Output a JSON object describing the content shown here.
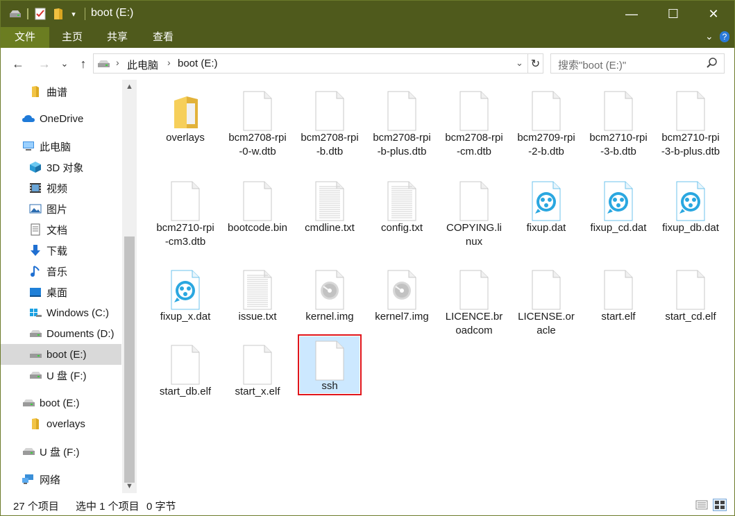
{
  "window": {
    "title": "boot (E:)",
    "minimize_glyph": "—",
    "maximize_glyph": "☐",
    "close_glyph": "✕"
  },
  "ribbon": {
    "tabs": [
      "文件",
      "主页",
      "共享",
      "查看"
    ],
    "collapse_glyph": "⌄",
    "help_glyph": "?"
  },
  "nav": {
    "back_glyph": "←",
    "forward_glyph": "→",
    "recent_glyph": "⌄",
    "up_glyph": "↑",
    "breadcrumbs": [
      "此电脑",
      "boot (E:)"
    ],
    "refresh_glyph": "↻",
    "dropdown_glyph": "⌄"
  },
  "search": {
    "placeholder": "搜索\"boot (E:)\""
  },
  "sidebar": {
    "items": [
      {
        "label": "曲谱",
        "icon": "folder-icon"
      },
      {
        "label": "OneDrive",
        "icon": "cloud-icon"
      },
      {
        "label": "此电脑",
        "icon": "computer-icon"
      },
      {
        "label": "3D 对象",
        "icon": "cube-icon"
      },
      {
        "label": "视频",
        "icon": "video-icon"
      },
      {
        "label": "图片",
        "icon": "picture-icon"
      },
      {
        "label": "文档",
        "icon": "document-icon"
      },
      {
        "label": "下载",
        "icon": "download-icon"
      },
      {
        "label": "音乐",
        "icon": "music-icon"
      },
      {
        "label": "桌面",
        "icon": "desktop-icon"
      },
      {
        "label": "Windows (C:)",
        "icon": "windows-drive-icon"
      },
      {
        "label": "Douments (D:)",
        "icon": "drive-icon"
      },
      {
        "label": "boot (E:)",
        "icon": "drive-icon"
      },
      {
        "label": "U 盘 (F:)",
        "icon": "drive-icon"
      },
      {
        "label": "boot (E:)",
        "icon": "drive-icon"
      },
      {
        "label": "overlays",
        "icon": "folder-icon"
      },
      {
        "label": "U 盘 (F:)",
        "icon": "drive-icon"
      },
      {
        "label": "网络",
        "icon": "network-icon"
      }
    ]
  },
  "files": [
    {
      "name": "overlays",
      "type": "folder"
    },
    {
      "name": "bcm2708-rpi-0-w.dtb",
      "type": "blank"
    },
    {
      "name": "bcm2708-rpi-b.dtb",
      "type": "blank"
    },
    {
      "name": "bcm2708-rpi-b-plus.dtb",
      "type": "blank"
    },
    {
      "name": "bcm2708-rpi-cm.dtb",
      "type": "blank"
    },
    {
      "name": "bcm2709-rpi-2-b.dtb",
      "type": "blank"
    },
    {
      "name": "bcm2710-rpi-3-b.dtb",
      "type": "blank"
    },
    {
      "name": "bcm2710-rpi-3-b-plus.dtb",
      "type": "blank"
    },
    {
      "name": "bcm2710-rpi-cm3.dtb",
      "type": "blank"
    },
    {
      "name": "bootcode.bin",
      "type": "blank"
    },
    {
      "name": "cmdline.txt",
      "type": "text"
    },
    {
      "name": "config.txt",
      "type": "text"
    },
    {
      "name": "COPYING.linux",
      "type": "blank"
    },
    {
      "name": "fixup.dat",
      "type": "media"
    },
    {
      "name": "fixup_cd.dat",
      "type": "media"
    },
    {
      "name": "fixup_db.dat",
      "type": "media"
    },
    {
      "name": "fixup_x.dat",
      "type": "media"
    },
    {
      "name": "issue.txt",
      "type": "text"
    },
    {
      "name": "kernel.img",
      "type": "disc"
    },
    {
      "name": "kernel7.img",
      "type": "disc"
    },
    {
      "name": "LICENCE.broadcom",
      "type": "blank"
    },
    {
      "name": "LICENSE.oracle",
      "type": "blank"
    },
    {
      "name": "start.elf",
      "type": "blank"
    },
    {
      "name": "start_cd.elf",
      "type": "blank"
    },
    {
      "name": "start_db.elf",
      "type": "blank"
    },
    {
      "name": "start_x.elf",
      "type": "blank"
    },
    {
      "name": "ssh",
      "type": "blank",
      "selected": true
    }
  ],
  "status": {
    "item_count": "27 个项目",
    "selection": "选中 1 个项目",
    "size": "0 字节"
  },
  "colors": {
    "titlebar": "#4f5a1c",
    "file_tab": "#6b7d21",
    "selection": "#cce8ff",
    "highlight_border": "#e0151b",
    "media_accent": "#2aa7e0"
  }
}
